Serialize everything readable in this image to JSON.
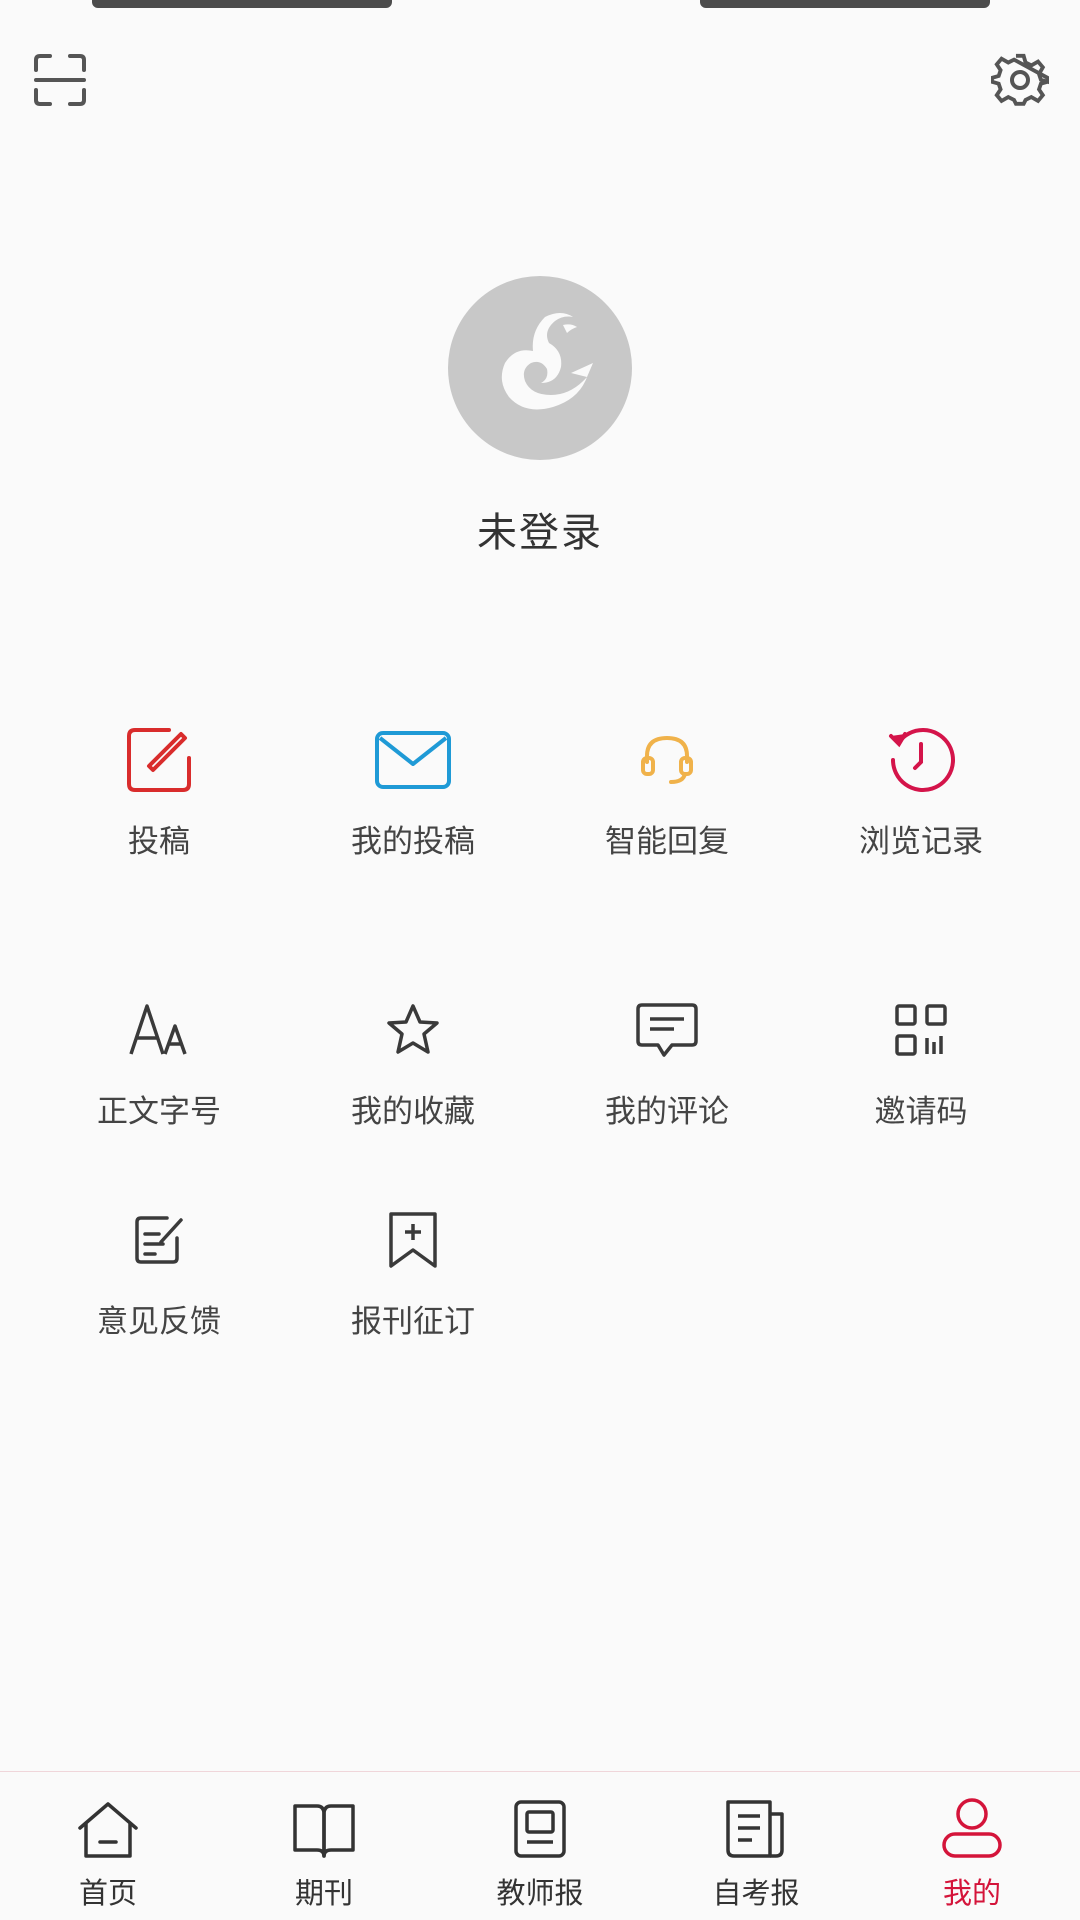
{
  "profile": {
    "login_status": "未登录"
  },
  "menu": {
    "row1": [
      {
        "label": "投稿",
        "icon": "edit-icon",
        "color": "#d92c2c"
      },
      {
        "label": "我的投稿",
        "icon": "mail-icon",
        "color": "#1f9ad6"
      },
      {
        "label": "智能回复",
        "icon": "headset-icon",
        "color": "#f0b24a"
      },
      {
        "label": "浏览记录",
        "icon": "history-icon",
        "color": "#d4144a"
      }
    ],
    "row2": [
      {
        "label": "正文字号",
        "icon": "font-size-icon"
      },
      {
        "label": "我的收藏",
        "icon": "star-icon"
      },
      {
        "label": "我的评论",
        "icon": "comment-icon"
      },
      {
        "label": "邀请码",
        "icon": "qr-code-icon"
      }
    ],
    "row3": [
      {
        "label": "意见反馈",
        "icon": "feedback-icon"
      },
      {
        "label": "报刊征订",
        "icon": "bookmark-add-icon"
      }
    ]
  },
  "tabs": [
    {
      "label": "首页",
      "icon": "home-icon"
    },
    {
      "label": "期刊",
      "icon": "book-icon"
    },
    {
      "label": "教师报",
      "icon": "teacher-newspaper-icon"
    },
    {
      "label": "自考报",
      "icon": "newspaper-icon"
    },
    {
      "label": "我的",
      "icon": "user-icon",
      "active": true
    }
  ],
  "colors": {
    "accent": "#d4143a",
    "text": "#333333",
    "icon_gray": "#3a3a3a",
    "avatar_bg": "#c8c8c8"
  }
}
